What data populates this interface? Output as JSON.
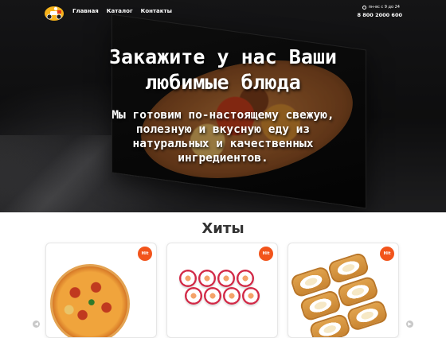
{
  "header": {
    "nav": [
      "Главная",
      "Каталог",
      "Контакты"
    ],
    "hours": "пн-вс с 9 до 24",
    "phone": "8 800 2000 600"
  },
  "hero": {
    "title_line1": "Закажите у нас Ваши",
    "title_line2": "любимые блюда",
    "sub_line1": "Мы готовим по-настоящему свежую,",
    "sub_line2": "полезную и вкусную еду из",
    "sub_line3": "натуральных и качественных",
    "sub_line4": "ингредиентов."
  },
  "hits": {
    "title": "Хиты",
    "cards": [
      {
        "badge": "Hit",
        "image": "pizza"
      },
      {
        "badge": "Hit",
        "image": "sushi-set"
      },
      {
        "badge": "Hit",
        "image": "fried-rolls"
      }
    ]
  },
  "colors": {
    "badge": "#f2541b",
    "hero_text": "#ffffff"
  },
  "icons": {
    "logo": "delivery-scooter-icon",
    "clock": "clock-icon",
    "prev": "chevron-left-icon",
    "next": "chevron-right-icon"
  }
}
